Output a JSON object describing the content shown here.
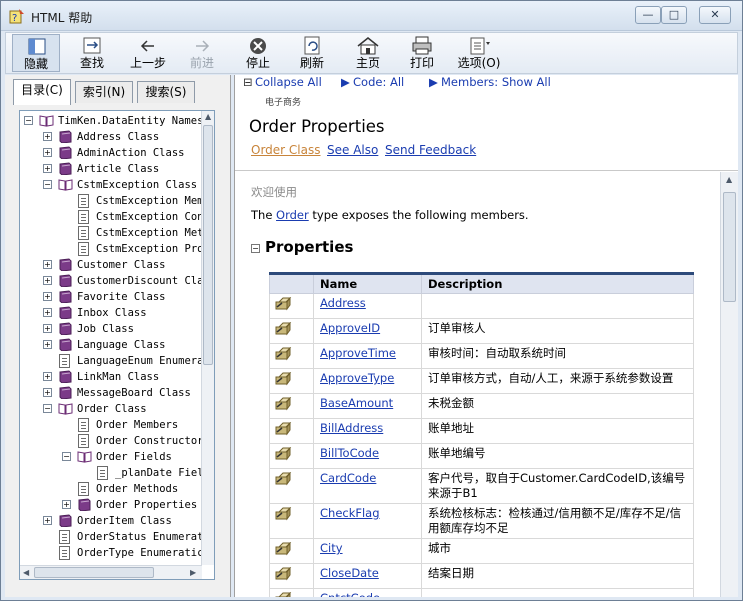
{
  "window": {
    "title": "HTML 帮助",
    "min_label": "—",
    "max_label": "□",
    "close_label": "✕"
  },
  "toolbar": {
    "buttons": [
      {
        "label": "隐藏",
        "icon": "hide-pane-icon",
        "enabled": true
      },
      {
        "label": "查找",
        "icon": "locate-icon",
        "enabled": true
      },
      {
        "label": "上一步",
        "icon": "back-arrow-icon",
        "enabled": true
      },
      {
        "label": "前进",
        "icon": "forward-arrow-icon",
        "enabled": false
      },
      {
        "label": "停止",
        "icon": "stop-icon",
        "enabled": true
      },
      {
        "label": "刷新",
        "icon": "refresh-icon",
        "enabled": true
      },
      {
        "label": "主页",
        "icon": "home-icon",
        "enabled": true
      },
      {
        "label": "打印",
        "icon": "print-icon",
        "enabled": true
      },
      {
        "label": "选项(O)",
        "icon": "options-icon",
        "enabled": true
      }
    ]
  },
  "tabs": [
    {
      "label": "目录(C)",
      "active": true
    },
    {
      "label": "索引(N)",
      "active": false
    },
    {
      "label": "搜索(S)",
      "active": false
    }
  ],
  "tree": [
    {
      "text": "TimKen.DataEntity Names",
      "level": 0,
      "expander": "−",
      "icon": "book-open"
    },
    {
      "text": "Address Class",
      "level": 1,
      "expander": "+",
      "icon": "book"
    },
    {
      "text": "AdminAction Class",
      "level": 1,
      "expander": "+",
      "icon": "book"
    },
    {
      "text": "Article Class",
      "level": 1,
      "expander": "+",
      "icon": "book"
    },
    {
      "text": "CstmException Class",
      "level": 1,
      "expander": "−",
      "icon": "book-open"
    },
    {
      "text": "CstmException Mem",
      "level": 2,
      "expander": "",
      "icon": "page"
    },
    {
      "text": "CstmException Con",
      "level": 2,
      "expander": "",
      "icon": "page"
    },
    {
      "text": "CstmException Met",
      "level": 2,
      "expander": "",
      "icon": "page"
    },
    {
      "text": "CstmException Pro",
      "level": 2,
      "expander": "",
      "icon": "page"
    },
    {
      "text": "Customer Class",
      "level": 1,
      "expander": "+",
      "icon": "book"
    },
    {
      "text": "CustomerDiscount Cla",
      "level": 1,
      "expander": "+",
      "icon": "book"
    },
    {
      "text": "Favorite Class",
      "level": 1,
      "expander": "+",
      "icon": "book"
    },
    {
      "text": "Inbox Class",
      "level": 1,
      "expander": "+",
      "icon": "book"
    },
    {
      "text": "Job Class",
      "level": 1,
      "expander": "+",
      "icon": "book"
    },
    {
      "text": "Language Class",
      "level": 1,
      "expander": "+",
      "icon": "book"
    },
    {
      "text": "LanguageEnum Enumera",
      "level": 1,
      "expander": "",
      "icon": "page"
    },
    {
      "text": "LinkMan Class",
      "level": 1,
      "expander": "+",
      "icon": "book"
    },
    {
      "text": "MessageBoard Class",
      "level": 1,
      "expander": "+",
      "icon": "book"
    },
    {
      "text": "Order Class",
      "level": 1,
      "expander": "−",
      "icon": "book-open"
    },
    {
      "text": "Order Members",
      "level": 2,
      "expander": "",
      "icon": "page"
    },
    {
      "text": "Order Constructor",
      "level": 2,
      "expander": "",
      "icon": "page"
    },
    {
      "text": "Order Fields",
      "level": 2,
      "expander": "−",
      "icon": "book-open"
    },
    {
      "text": "_planDate Fiel",
      "level": 3,
      "expander": "",
      "icon": "page"
    },
    {
      "text": "Order Methods",
      "level": 2,
      "expander": "",
      "icon": "page"
    },
    {
      "text": "Order Properties",
      "level": 2,
      "expander": "+",
      "icon": "book"
    },
    {
      "text": "OrderItem Class",
      "level": 1,
      "expander": "+",
      "icon": "book"
    },
    {
      "text": "OrderStatus Enumerat",
      "level": 1,
      "expander": "",
      "icon": "page"
    },
    {
      "text": "OrderType Enumeratic",
      "level": 1,
      "expander": "",
      "icon": "page"
    }
  ],
  "topic": {
    "collapse_all": "Collapse All",
    "code_all": "Code: All",
    "members_show_all": "Members: Show All",
    "breadcrumb": "电子商务",
    "title": "Order Properties",
    "link_order_class": "Order Class",
    "link_see_also": "See Also",
    "link_send_feedback": "Send Feedback",
    "welcome": "欢迎使用",
    "intro_before": "The ",
    "intro_link": "Order",
    "intro_after": " type exposes the following members.",
    "section_toggle": "−",
    "section_title": "Properties",
    "table_headers": [
      "",
      "Name",
      "Description"
    ],
    "properties": [
      {
        "name": "Address",
        "description": ""
      },
      {
        "name": "ApproveID",
        "description": "订单审核人"
      },
      {
        "name": "ApproveTime",
        "description": "审核时间：自动取系统时间"
      },
      {
        "name": "ApproveType",
        "description": "订单审核方式，自动/人工，来源于系统参数设置"
      },
      {
        "name": "BaseAmount",
        "description": "未税金额"
      },
      {
        "name": "BillAddress",
        "description": "账单地址"
      },
      {
        "name": "BillToCode",
        "description": "账单地编号"
      },
      {
        "name": "CardCode",
        "description": "客户代号，取自于Customer.CardCodeID,该编号来源于B1"
      },
      {
        "name": "CheckFlag",
        "description": "系统检核标志：检核通过/信用额不足/库存不足/信用额库存均不足"
      },
      {
        "name": "City",
        "description": "城市"
      },
      {
        "name": "CloseDate",
        "description": "结案日期"
      },
      {
        "name": "CntctCode",
        "description": ""
      }
    ]
  },
  "colors": {
    "link": "#1a3cb0",
    "visited_link": "#c8843a",
    "header_bar": "#2d4a7a"
  }
}
